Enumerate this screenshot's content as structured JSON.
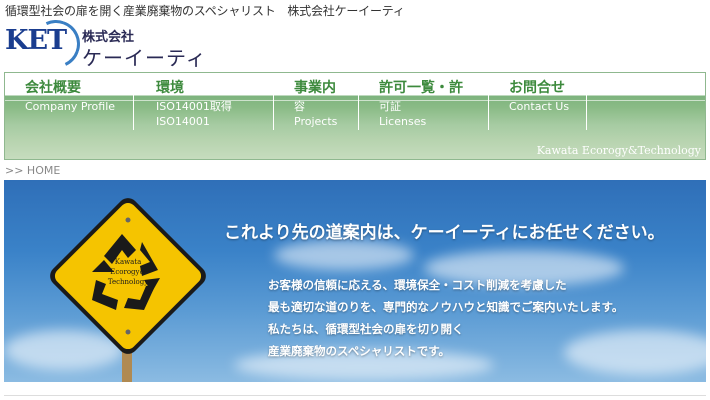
{
  "header": {
    "tagline": "循環型社会の扉を開く産業廃棄物のスペシャリスト　株式会社ケーイーティ",
    "logo_text": "KET",
    "company_prefix": "株式会社",
    "company_name": "ケーイーティ"
  },
  "nav": {
    "items": [
      {
        "jp": "会社概要",
        "en": "Company Profile",
        "en2": ""
      },
      {
        "jp": "環境",
        "en": "ISO14001取得",
        "en2": "ISO14001"
      },
      {
        "jp": "事業内",
        "en": "容",
        "en2": "Projects"
      },
      {
        "jp": "許可一覧・許",
        "en": "可証",
        "en2": "Licenses"
      },
      {
        "jp": "お問合せ",
        "en": "Contact Us",
        "en2": ""
      }
    ],
    "footer": "Kawata Ecorogy&Technology"
  },
  "breadcrumb": ">> HOME",
  "hero": {
    "title": "これより先の道案内は、ケーイーティにお任せください。",
    "body": [
      "お客様の信頼に応える、環境保全・コスト削減を考慮した",
      "最も適切な道のりを、専門的なノウハウと知識でご案内いたします。",
      "私たちは、循環型社会の扉を切り開く",
      "産業廃棄物のスペシャリストです。"
    ],
    "sign_text": [
      "Kawata",
      "Ecorogy&",
      "Technology"
    ]
  },
  "colors": {
    "nav_green": "#3d8a3d",
    "brand_blue": "#1a3d8f",
    "sign_yellow": "#f5c400"
  }
}
